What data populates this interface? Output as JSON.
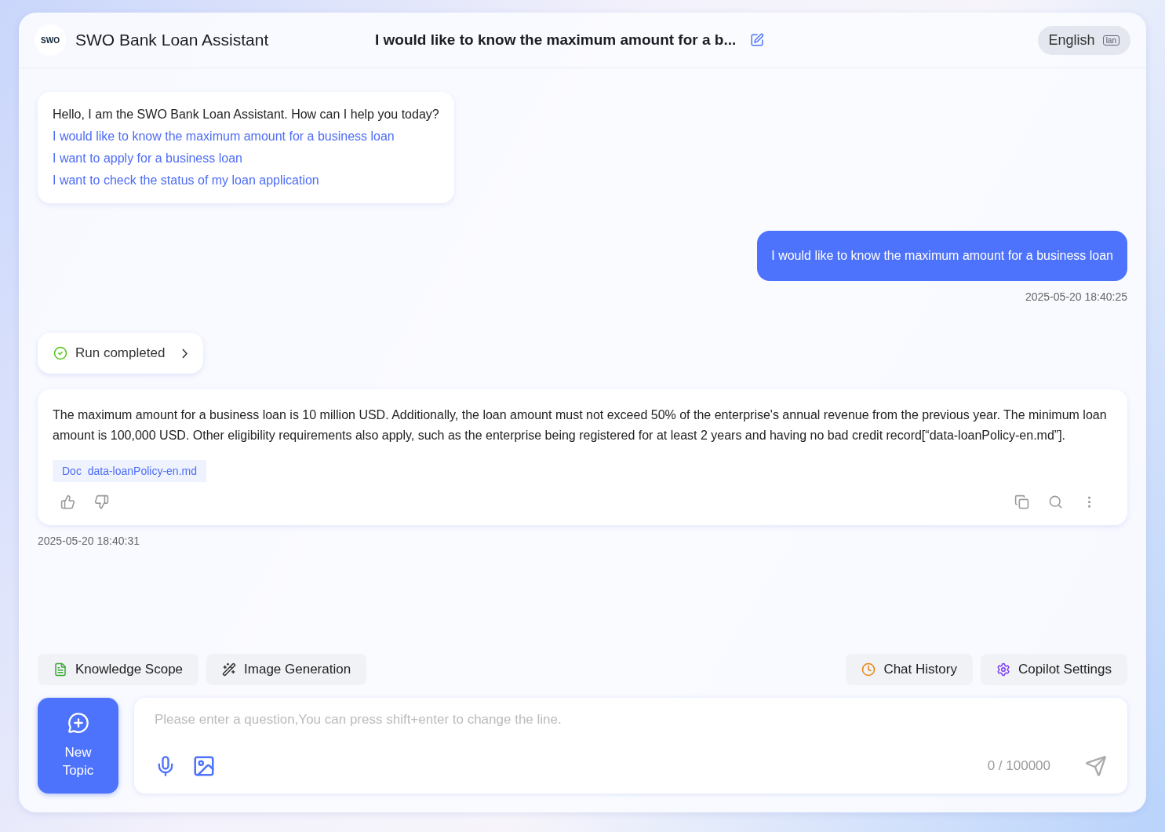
{
  "header": {
    "logo_text": "SWO",
    "title": "SWO Bank Loan Assistant",
    "conversation_title": "I would like to know the maximum amount for a b...",
    "language": "English",
    "language_icon_text": "lan"
  },
  "messages": [
    {
      "kind": "greeting",
      "text": "Hello, I am the SWO Bank Loan Assistant. How can I help you today?",
      "suggestions": [
        "I would like to know the maximum amount for a business loan",
        "I want to apply for a business loan",
        "I want to check the status of my loan application"
      ]
    },
    {
      "kind": "user",
      "text": "I would like to know the maximum amount for a business loan",
      "time": "2025-05-20 18:40:25"
    },
    {
      "kind": "status",
      "text": "Run completed"
    },
    {
      "kind": "answer",
      "text": "The maximum amount for a business loan is 10 million USD. Additionally, the loan amount must not exceed 50% of the enterprise's annual revenue from the previous year. The minimum loan amount is 100,000 USD. Other eligibility requirements also apply, such as the enterprise being registered for at least 2 years and having no bad credit record[“data-loanPolicy-en.md”].",
      "doc": "Doc  data-loanPolicy-en.md",
      "time": "2025-05-20 18:40:31"
    }
  ],
  "tools_left": [
    {
      "kind": "knowledge",
      "label": "Knowledge Scope"
    },
    {
      "kind": "image",
      "label": "Image Generation"
    }
  ],
  "tools_right": [
    {
      "kind": "history",
      "label": "Chat History"
    },
    {
      "kind": "settings",
      "label": "Copilot Settings"
    }
  ],
  "new_topic": "New Topic",
  "input": {
    "placeholder": "Please enter a question,You can press shift+enter to change the line.",
    "counter": "0 / 100000"
  }
}
